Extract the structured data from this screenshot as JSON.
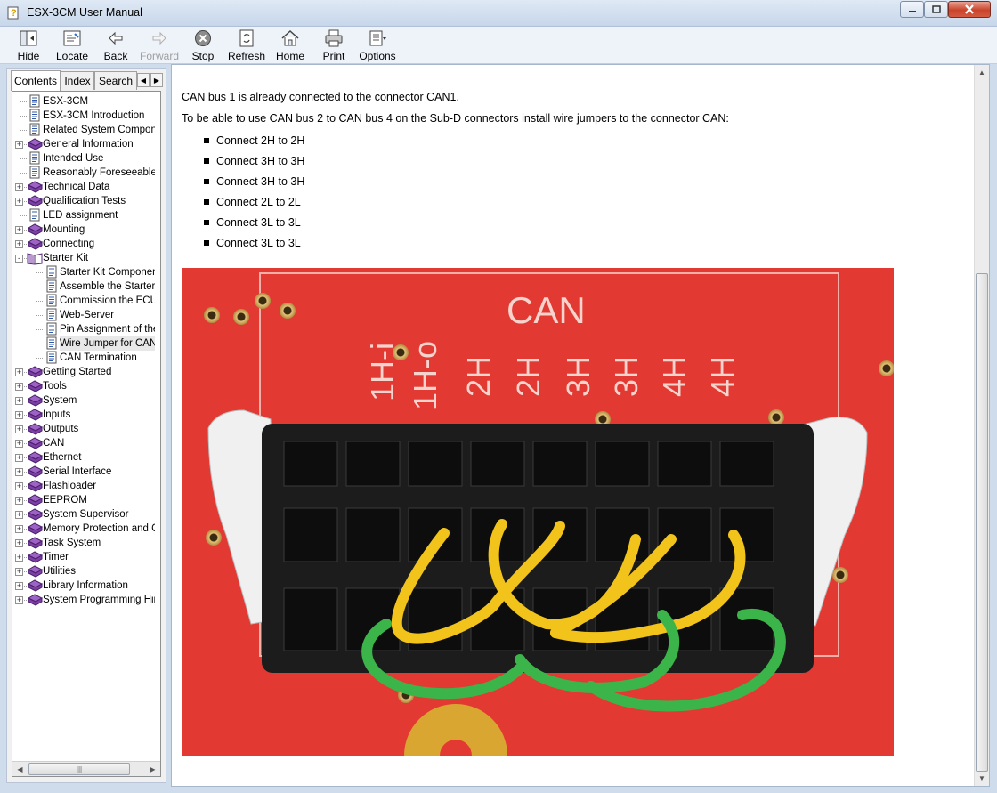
{
  "window": {
    "title": "ESX-3CM User Manual"
  },
  "toolbar": {
    "buttons": [
      {
        "label": "Hide",
        "icon": "hide-icon"
      },
      {
        "label": "Locate",
        "icon": "locate-icon"
      },
      {
        "label": "Back",
        "icon": "back-arrow-icon"
      },
      {
        "label": "Forward",
        "icon": "forward-arrow-icon",
        "disabled": true
      },
      {
        "label": "Stop",
        "icon": "stop-icon"
      },
      {
        "label": "Refresh",
        "icon": "refresh-icon"
      },
      {
        "label": "Home",
        "icon": "home-icon"
      },
      {
        "label": "Print",
        "icon": "print-icon"
      },
      {
        "label": "Options",
        "icon": "options-icon"
      }
    ]
  },
  "navpane": {
    "tabs": [
      "Contents",
      "Index",
      "Search"
    ],
    "active_tab": "Contents",
    "tree": [
      {
        "label": "ESX-3CM",
        "type": "page",
        "level": 0
      },
      {
        "label": "ESX-3CM Introduction",
        "type": "page",
        "level": 0
      },
      {
        "label": "Related System Compone",
        "type": "page",
        "level": 0
      },
      {
        "label": "General Information",
        "type": "book",
        "level": 0,
        "expander": "+"
      },
      {
        "label": "Intended Use",
        "type": "page",
        "level": 0
      },
      {
        "label": "Reasonably Foreseeable",
        "type": "page",
        "level": 0
      },
      {
        "label": "Technical Data",
        "type": "book",
        "level": 0,
        "expander": "+"
      },
      {
        "label": "Qualification Tests",
        "type": "book",
        "level": 0,
        "expander": "+"
      },
      {
        "label": "LED assignment",
        "type": "page",
        "level": 0
      },
      {
        "label": "Mounting",
        "type": "book",
        "level": 0,
        "expander": "+"
      },
      {
        "label": "Connecting",
        "type": "book",
        "level": 0,
        "expander": "+"
      },
      {
        "label": "Starter Kit",
        "type": "book-open",
        "level": 0,
        "expander": "-"
      },
      {
        "label": "Starter Kit Component",
        "type": "page",
        "level": 1
      },
      {
        "label": "Assemble the Starter",
        "type": "page",
        "level": 1
      },
      {
        "label": "Commission the ECU",
        "type": "page",
        "level": 1
      },
      {
        "label": "Web-Server",
        "type": "page",
        "level": 1
      },
      {
        "label": "Pin Assignment of the",
        "type": "page",
        "level": 1
      },
      {
        "label": "Wire Jumper for CAN",
        "type": "page",
        "level": 1,
        "selected": true
      },
      {
        "label": "CAN Termination",
        "type": "page",
        "level": 1
      },
      {
        "label": "Getting Started",
        "type": "book",
        "level": 0,
        "expander": "+"
      },
      {
        "label": "Tools",
        "type": "book",
        "level": 0,
        "expander": "+"
      },
      {
        "label": "System",
        "type": "book",
        "level": 0,
        "expander": "+"
      },
      {
        "label": "Inputs",
        "type": "book",
        "level": 0,
        "expander": "+"
      },
      {
        "label": "Outputs",
        "type": "book",
        "level": 0,
        "expander": "+"
      },
      {
        "label": "CAN",
        "type": "book",
        "level": 0,
        "expander": "+"
      },
      {
        "label": "Ethernet",
        "type": "book",
        "level": 0,
        "expander": "+"
      },
      {
        "label": "Serial Interface",
        "type": "book",
        "level": 0,
        "expander": "+"
      },
      {
        "label": "Flashloader",
        "type": "book",
        "level": 0,
        "expander": "+"
      },
      {
        "label": "EEPROM",
        "type": "book",
        "level": 0,
        "expander": "+"
      },
      {
        "label": "System Supervisor",
        "type": "book",
        "level": 0,
        "expander": "+"
      },
      {
        "label": "Memory Protection and Cl",
        "type": "book",
        "level": 0,
        "expander": "+"
      },
      {
        "label": "Task System",
        "type": "book",
        "level": 0,
        "expander": "+"
      },
      {
        "label": "Timer",
        "type": "book",
        "level": 0,
        "expander": "+"
      },
      {
        "label": "Utilities",
        "type": "book",
        "level": 0,
        "expander": "+"
      },
      {
        "label": "Library Information",
        "type": "book",
        "level": 0,
        "expander": "+"
      },
      {
        "label": "System Programming Hint",
        "type": "book",
        "level": 0,
        "expander": "+"
      }
    ]
  },
  "content": {
    "intro": "CAN bus 1 is already connected to the connector CAN1.",
    "instruction": "To be able to use CAN bus 2 to CAN bus 4 on the Sub-D connectors install wire jumpers to the connector CAN:",
    "bullets": [
      "Connect 2H to 2H",
      "Connect 3H to 3H",
      "Connect 3H to 3H",
      "Connect 2L to 2L",
      "Connect 3L to 3L",
      "Connect 3L to 3L"
    ],
    "photo": {
      "board_label": "CAN",
      "pin_labels": [
        "1H-i",
        "1H-o",
        "2H",
        "2H",
        "3H",
        "3H",
        "4H",
        "4H"
      ]
    }
  }
}
